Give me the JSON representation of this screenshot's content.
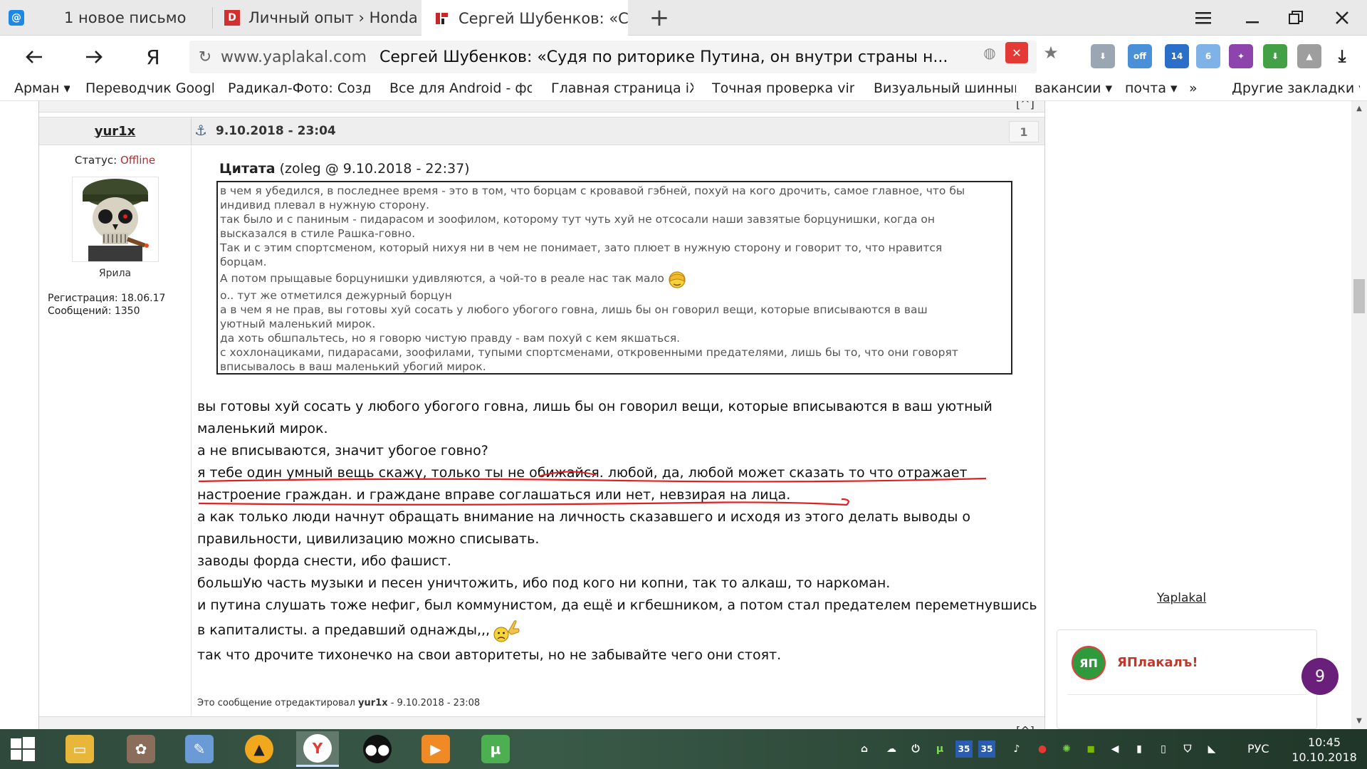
{
  "browser": {
    "tabs": [
      {
        "label": "1 новое письмо",
        "icon": "mail-icon",
        "active": false
      },
      {
        "label": "Личный опыт › Honda CR-V",
        "icon": "drive-icon",
        "active": false
      },
      {
        "label": "Сергей Шубенков: «Судя",
        "icon": "yaplakal-icon",
        "active": true
      }
    ],
    "new_tab_symbol": "+",
    "address": {
      "reload_symbol": "↻",
      "host": "www.yaplakal.com",
      "page_title": "Сергей Шубенков: «Судя по риторике Путина, он внутри страны н..."
    },
    "yandex_button": "Я",
    "bookmarks": [
      "Арман ▾",
      "Переводчик Google",
      "Радикал-Фото: Создай",
      "Все для Android - фору",
      "Главная страница iXBT",
      "Точная проверка vin н",
      "Визуальный шинный к",
      "вакансии ▾",
      "почта ▾",
      "»",
      "Другие закладки ▾"
    ]
  },
  "post": {
    "author": "yur1x",
    "date": "9.10.2018 - 23:04",
    "number": "1",
    "status_label": "Статус: ",
    "status_value": "Offline",
    "user_title": "Ярила",
    "registration": "Регистрация: 18.06.17",
    "messages": "Сообщений: 1350",
    "quote_label": "Цитата",
    "quote_meta": " (zoleg @ 9.10.2018 - 22:37)",
    "quote_lines": [
      "в чем я убедился, в последнее время - это в том, что борцам с кровавой гэбней, похуй на кого дрочить, самое главное, что бы",
      "индивид плевал в нужную сторону.",
      "так было и с паниным - пидарасом и зоофилом, которому тут чуть хуй не отсосали наши завзятые борцунишки, когда он",
      "высказался в стиле Рашка-говно.",
      "Так и с этим спортсменом, который нихуя ни в чем не понимает, зато плюет в нужную сторону и говорит то, что нравится",
      "борцам.",
      "А потом прыщавые борцунишки удивляются, а чой-то в реале нас так мало",
      "о.. тут же отметился дежурный борцун",
      "а в чем я не прав, вы готовы хуй сосать у любого убогого говна, лишь бы он говорил вещи, которые вписываются в ваш",
      "уютный маленький мирок.",
      "да хоть обшпальтесь, но я говорю чистую правду - вам похуй с кем якшаться.",
      "с хохлонациками, пидарасами, зоофилами, тупыми спортсменами, откровенными предателями, лишь бы то, что они говорят",
      "вписывалось в ваш маленький убогий мирок."
    ],
    "body_lines": [
      "вы готовы хуй сосать у любого убогого говна, лишь бы он говорил вещи, которые вписываются в ваш уютный",
      "маленький мирок.",
      "а не вписываются, значит убогое говно?",
      "я тебе один умный вещь скажу, только ты не обижайся. любой, да, любой может сказать то что отражает",
      "настроение граждан. и граждане вправе соглашаться или нет, невзирая на лица.",
      "а как только люди начнут обращать внимание на личность сказавшего и исходя из этого делать выводы о",
      "правильности, цивилизацию можно списывать.",
      "заводы форда снести, ибо фашист.",
      "большУю часть музыки и песен уничтожить, ибо под кого ни копни, так то алкаш, то наркоман.",
      "и путина слушать тоже нефиг, был коммунистом, да ещё и кгбешником, а потом стал предателем переметнувшись",
      "в капиталисты. а предавший однажды,,,",
      "так что дрочите тихонечко на свои авторитеты, но не забывайте чего они стоят."
    ],
    "edit_prefix": "Это сообщение отредактировал ",
    "edit_user": "yur1x",
    "edit_date": " - 9.10.2018 - 23:08",
    "top_link": "[^]",
    "annotation_color": "#e02020"
  },
  "sidebar": {
    "link": "Yaplakal",
    "widget_logo": "ЯП",
    "widget_name": "ЯПлакалъ!",
    "notification_count": "9"
  },
  "taskbar": {
    "apps": [
      "start-icon",
      "file-explorer-icon",
      "tree-app-icon",
      "paint-icon",
      "aimp-icon",
      "yandex-browser-icon",
      "panda-icon",
      "media-player-icon",
      "utorrent-icon"
    ],
    "tray_counts": [
      "35",
      "35"
    ],
    "language": "РУС",
    "time": "10:45",
    "date": "10.10.2018"
  }
}
